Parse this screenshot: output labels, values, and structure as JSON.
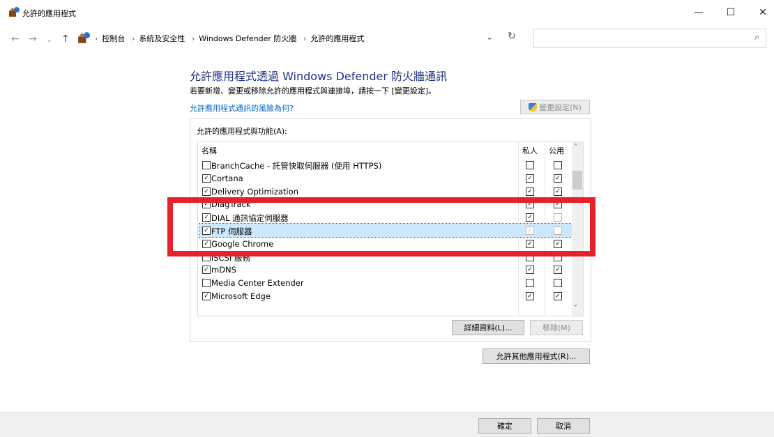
{
  "window": {
    "title": "允許的應用程式",
    "minimize_glyph": "—",
    "maximize_glyph": "☐",
    "close_glyph": "✕"
  },
  "nav": {
    "back_glyph": "←",
    "forward_glyph": "→",
    "recent_glyph": "⌄",
    "up_glyph": "↑",
    "sep_glyph": "›",
    "breadcrumbs": [
      "控制台",
      "系統及安全性",
      "Windows Defender 防火牆",
      "允許的應用程式"
    ],
    "dropdown_glyph": "⌄",
    "refresh_glyph": "↻",
    "search_placeholder": "",
    "search_glyph": "⌕"
  },
  "main": {
    "heading": "允許應用程式透過 Windows Defender 防火牆通訊",
    "subtext": "若要新增、變更或移除允許的應用程式與連接埠，請按一下 [變更設定]。",
    "risk_link": "允許應用程式通訊的風險為何?",
    "change_settings": "變更設定(N)",
    "group_title": "允許的應用程式與功能(A):",
    "columns": {
      "name": "名稱",
      "private": "私人",
      "public": "公用"
    },
    "details_button": "詳細資料(L)...",
    "remove_button": "移除(M)",
    "allow_other_button": "允許其他應用程式(R)..."
  },
  "apps": [
    {
      "name": "BranchCache - 託管快取伺服器 (使用 HTTPS)",
      "enabled": false,
      "private": false,
      "public": false,
      "state": "normal"
    },
    {
      "name": "Cortana",
      "enabled": true,
      "private": true,
      "public": true,
      "state": "normal"
    },
    {
      "name": "Delivery Optimization",
      "enabled": true,
      "private": true,
      "public": true,
      "state": "normal"
    },
    {
      "name": "DiagTrack",
      "enabled": true,
      "private": true,
      "public": true,
      "state": "normal"
    },
    {
      "name": "DIAL 通訊協定伺服器",
      "enabled": true,
      "private": true,
      "public": false,
      "state": "faint-public"
    },
    {
      "name": "FTP 伺服器",
      "enabled": true,
      "private": true,
      "public": false,
      "state": "selected"
    },
    {
      "name": "Google Chrome",
      "enabled": true,
      "private": true,
      "public": true,
      "state": "normal"
    },
    {
      "name": "iSCSI 服務",
      "enabled": false,
      "private": false,
      "public": false,
      "state": "normal"
    },
    {
      "name": "mDNS",
      "enabled": true,
      "private": true,
      "public": true,
      "state": "normal"
    },
    {
      "name": "Media Center Extender",
      "enabled": false,
      "private": false,
      "public": false,
      "state": "normal"
    },
    {
      "name": "Microsoft Edge",
      "enabled": true,
      "private": true,
      "public": true,
      "state": "normal"
    }
  ],
  "scrollbar": {
    "up_glyph": "˄",
    "down_glyph": "˅"
  },
  "footer": {
    "ok": "確定",
    "cancel": "取消"
  },
  "colors": {
    "highlight": "#e8202a",
    "link": "#0066cc",
    "heading": "#1e3287",
    "selected_row": "#cce8ff"
  }
}
